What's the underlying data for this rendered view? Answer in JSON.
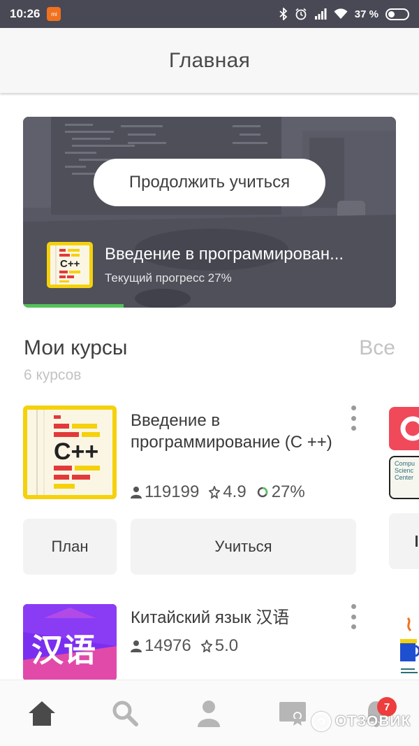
{
  "status_bar": {
    "time": "10:26",
    "battery": "37 %"
  },
  "app_bar": {
    "title": "Главная"
  },
  "hero": {
    "continue_label": "Продолжить учиться",
    "course_title": "Введение в программирован...",
    "progress_text": "Текущий прогресс 27%",
    "progress_fraction": 0.27
  },
  "my_courses": {
    "title": "Мои курсы",
    "all_label": "Все",
    "count_label": "6 курсов",
    "items": [
      {
        "title": "Введение в программирование (C ++)",
        "learners": "119199",
        "rating": "4.9",
        "progress": "27%",
        "plan_label": "План",
        "learn_label": "Учиться",
        "thumb_text": "C++"
      },
      {
        "title": "Китайский язык 汉语",
        "learners": "14976",
        "rating": "5.0",
        "thumb_text": "汉语"
      }
    ],
    "peek_top_text": "Compu Scienc Center"
  },
  "bottom_nav": {
    "items": [
      "home-icon",
      "search-icon",
      "profile-icon",
      "certificate-icon",
      "notifications-icon"
    ],
    "notification_count": "7"
  },
  "watermark": {
    "text": "ОТЗОВИК"
  },
  "colors": {
    "accent_green": "#54c35a",
    "thumb_yellow": "#f5d10c",
    "badge_red": "#ee3d3d",
    "peek_red": "#f0495a"
  }
}
